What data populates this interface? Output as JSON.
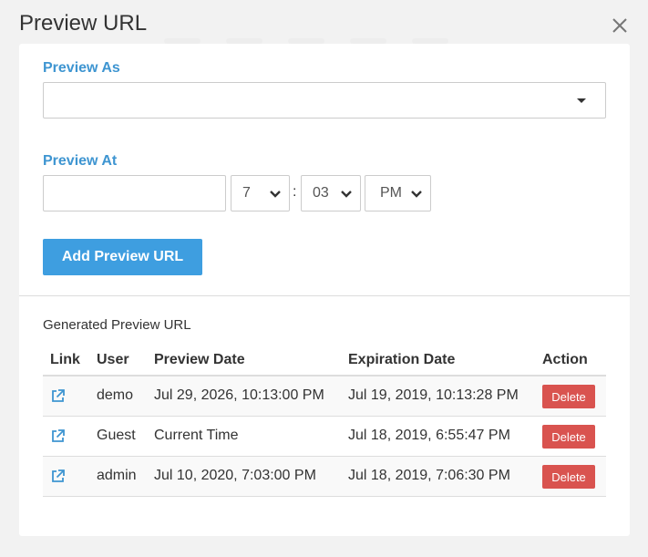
{
  "modal": {
    "title": "Preview URL"
  },
  "form": {
    "preview_as_label": "Preview As",
    "preview_as_value": "",
    "preview_at_label": "Preview At",
    "date_value": "",
    "hour_value": "7",
    "minute_value": "03",
    "ampm_value": "PM",
    "time_separator": ":",
    "add_button_label": "Add Preview URL"
  },
  "generated": {
    "title": "Generated Preview URL",
    "columns": [
      "Link",
      "User",
      "Preview Date",
      "Expiration Date",
      "Action"
    ],
    "rows": [
      {
        "user": "demo",
        "preview_date": "Jul 29, 2026, 10:13:00 PM",
        "expiration_date": "Jul 19, 2019, 10:13:28 PM",
        "action": "Delete"
      },
      {
        "user": "Guest",
        "preview_date": "Current Time",
        "expiration_date": "Jul 18, 2019, 6:55:47 PM",
        "action": "Delete"
      },
      {
        "user": "admin",
        "preview_date": "Jul 10, 2020, 7:03:00 PM",
        "expiration_date": "Jul 18, 2019, 7:06:30 PM",
        "action": "Delete"
      }
    ]
  },
  "icons": {
    "close": "close-icon",
    "select_caret": "caret-down-icon",
    "time_chevron": "chevron-down-icon",
    "row_link": "external-link-icon"
  },
  "colors": {
    "accent_blue": "#3e95d1",
    "button_blue": "#3e9ee0",
    "delete_red": "#d9534f",
    "background": "#f2f2f2"
  }
}
